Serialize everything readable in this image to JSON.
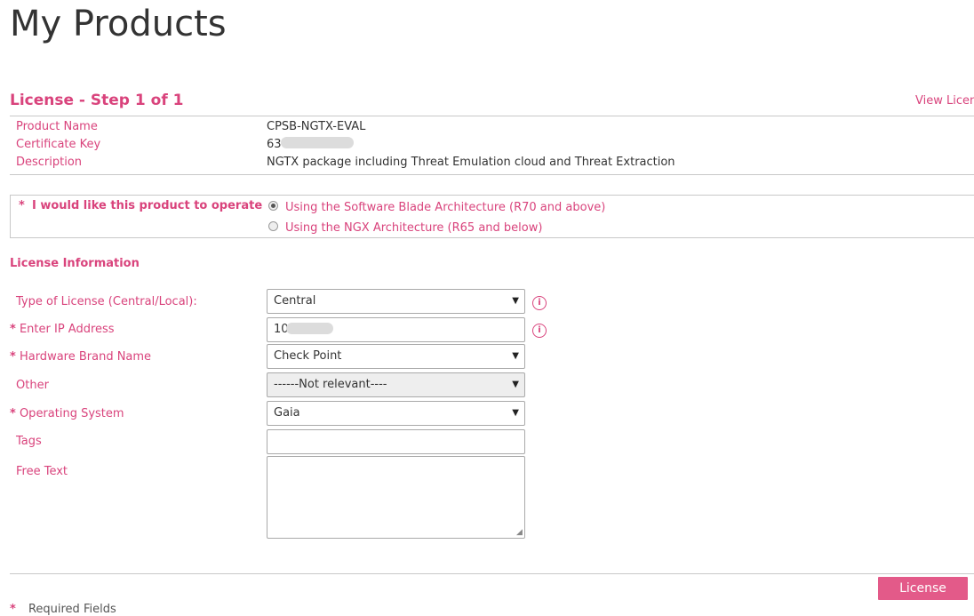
{
  "page": {
    "title": "My Products"
  },
  "license": {
    "step_title": "License - Step 1 of 1",
    "view_link": "View Licen"
  },
  "product": {
    "name_label": "Product Name",
    "name_value": "CPSB-NGTX-EVAL",
    "cert_label": "Certificate Key",
    "cert_value": "63",
    "desc_label": "Description",
    "desc_value": "NGTX package including Threat Emulation cloud and Threat Extraction"
  },
  "operate": {
    "required_mark": "*",
    "label": "I would like this product to operate",
    "options": [
      {
        "label": "Using the Software Blade Architecture (R70 and above)",
        "checked": true
      },
      {
        "label": "Using the NGX Architecture (R65 and below)",
        "checked": false
      }
    ]
  },
  "info": {
    "section_title": "License Information",
    "license_type": {
      "label": "Type of License (Central/Local):",
      "value": "Central"
    },
    "ip": {
      "required_mark": "*",
      "label": "Enter IP Address",
      "value": "10."
    },
    "hardware": {
      "required_mark": "*",
      "label": "Hardware Brand Name",
      "value": "Check Point"
    },
    "other": {
      "label": "Other",
      "value": "------Not relevant----"
    },
    "os": {
      "required_mark": "*",
      "label": "Operating System",
      "value": "Gaia"
    },
    "tags": {
      "label": "Tags",
      "value": ""
    },
    "free_text": {
      "label": "Free Text",
      "value": ""
    }
  },
  "footer": {
    "license_button": "License",
    "required_mark": "*",
    "required_note": "Required Fields"
  },
  "icons": {
    "info": "info-circle-icon",
    "dropdown": "caret-down-icon"
  },
  "colors": {
    "accent": "#d9437c",
    "button_bg": "#e35a89",
    "border": "#c8c8c8"
  }
}
